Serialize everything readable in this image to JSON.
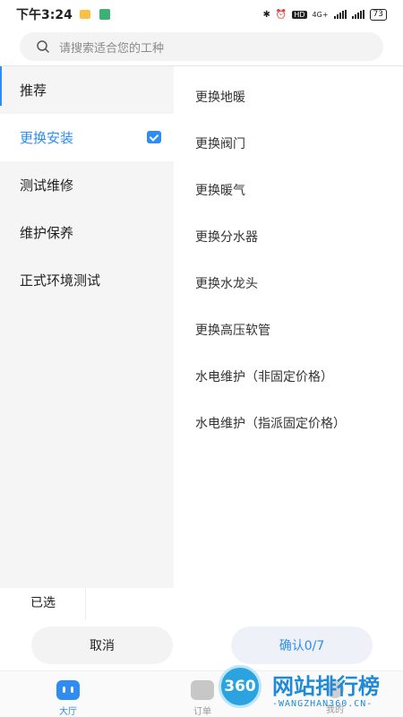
{
  "status_bar": {
    "time": "下午3:24",
    "network": "4G+",
    "hd": "HD",
    "battery": "73"
  },
  "search": {
    "placeholder": "请搜索适合您的工种"
  },
  "sidebar": {
    "items": [
      {
        "label": "推荐",
        "active": false
      },
      {
        "label": "更换安装",
        "active": true
      },
      {
        "label": "测试维修",
        "active": false
      },
      {
        "label": "维护保养",
        "active": false
      },
      {
        "label": "正式环境测试",
        "active": false
      }
    ]
  },
  "content": {
    "items": [
      {
        "label": "更换地暖"
      },
      {
        "label": "更换阀门"
      },
      {
        "label": "更换暖气"
      },
      {
        "label": "更换分水器"
      },
      {
        "label": "更换水龙头"
      },
      {
        "label": "更换高压软管"
      },
      {
        "label": "水电维护（非固定价格）"
      },
      {
        "label": "水电维护（指派固定价格）"
      }
    ]
  },
  "footer": {
    "selected_label": "已选",
    "cancel_label": "取消",
    "confirm_label": "确认0/7"
  },
  "tabs": [
    {
      "label": "大厅",
      "icon": "hall-icon",
      "active": true
    },
    {
      "label": "订单",
      "icon": "order-icon",
      "active": false
    },
    {
      "label": "我的",
      "icon": "profile-icon",
      "active": false
    }
  ],
  "watermark": {
    "logo_text": "360",
    "title": "网站排行榜",
    "subtitle": "-WANGZHAN360.CN-"
  },
  "colors": {
    "accent": "#2f8cf0",
    "sidebar_bg": "#f5f5f5"
  }
}
